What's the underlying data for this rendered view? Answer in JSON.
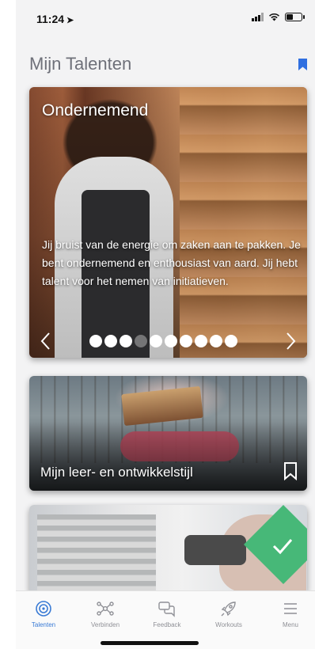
{
  "status": {
    "time": "11:24"
  },
  "header": {
    "title": "Mijn Talenten"
  },
  "talent_card": {
    "title": "Ondernemend",
    "description": "Jij bruist van de energie om zaken aan te pakken. Je bent ondernemend en enthousiast van aard. Jij hebt talent voor het nemen van initiatieven.",
    "dots_total": 10,
    "dots_active_index": 3
  },
  "style_card": {
    "title": "Mijn leer- en ontwikkelstijl"
  },
  "colors": {
    "accent": "#2f6fe0",
    "check": "#47b878",
    "tab_active": "#3a7bd5"
  },
  "tabs": [
    {
      "label": "Talenten",
      "icon": "target-icon"
    },
    {
      "label": "Verbinden",
      "icon": "network-icon"
    },
    {
      "label": "Feedback",
      "icon": "chat-icon"
    },
    {
      "label": "Workouts",
      "icon": "rocket-icon"
    },
    {
      "label": "Menu",
      "icon": "menu-icon"
    }
  ]
}
